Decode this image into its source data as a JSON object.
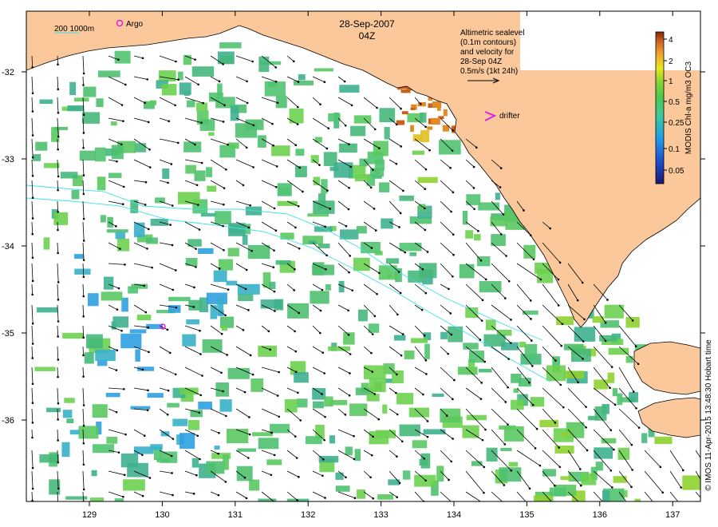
{
  "map": {
    "date": "28-Sep-2007",
    "time": "04Z",
    "lon_ticks": [
      "129",
      "130",
      "131",
      "132",
      "133",
      "134",
      "135",
      "136",
      "137"
    ],
    "lat_ticks": [
      "-32",
      "-33",
      "-34",
      "-35",
      "-36"
    ],
    "depth_legend": "200  1000m",
    "argo_label": "Argo",
    "drifter_label": "drifter",
    "sealevel_note": [
      "Altimetric sealevel",
      "(0.1m contours)",
      "and velocity for",
      "28-Sep 04Z",
      "0.5m/s (1kt 24h)"
    ],
    "colorbar_title": "MODIS Chl-a mg/m3 OC3",
    "colorbar_ticks": [
      "4",
      "2",
      "1",
      "0.5",
      "0.25",
      "0.1",
      "0.05"
    ],
    "credit": "© IMOS 11-Apr-2015 13:48:30 Hobart time",
    "colors": {
      "land": "#fac89a",
      "ocean": "#ffffff",
      "chl_low": "#1f8fe0",
      "chl_mid": "#3fbf7a",
      "chl_high": "#7fd040",
      "arrow": "#000000",
      "isobath": "#40e0e8",
      "argo": "#e020e0",
      "drifter": "#e020e0"
    }
  }
}
